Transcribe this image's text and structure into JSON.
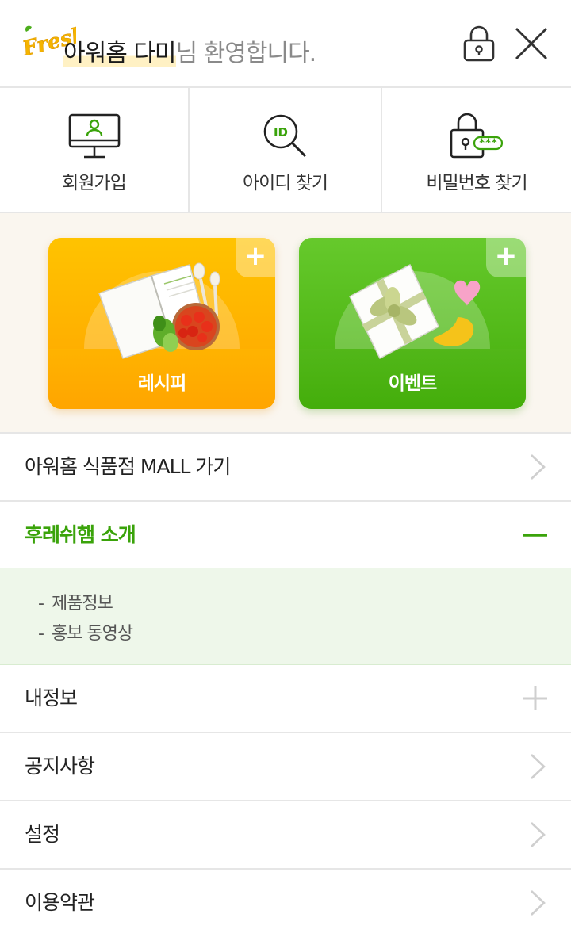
{
  "header": {
    "user_name": "아워홈 다미",
    "greeting_suffix": "님 환영합니다.",
    "logo_text": "Fresh",
    "lock_icon": "lock-icon",
    "close_icon": "close-icon"
  },
  "quick_menu": [
    {
      "label": "회원가입",
      "icon": "monitor-user-icon"
    },
    {
      "label": "아이디 찾기",
      "icon": "id-search-icon"
    },
    {
      "label": "비밀번호 찾기",
      "icon": "lock-password-icon"
    }
  ],
  "banners": {
    "recipe": {
      "label": "레시피",
      "plus": "+"
    },
    "event": {
      "label": "이벤트",
      "plus": "+"
    }
  },
  "menu": {
    "mall": "아워홈 식품점 MALL 가기",
    "intro": "후레쉬햄 소개",
    "intro_sub": [
      "제품정보",
      "홍보 동영상"
    ],
    "myinfo": "내정보",
    "notice": "공지사항",
    "settings": "설정",
    "terms": "이용약관"
  },
  "colors": {
    "accent_green": "#3aa30a",
    "recipe_orange": "#ffa400",
    "event_green": "#43ad0a",
    "highlight": "#fff1c4"
  }
}
